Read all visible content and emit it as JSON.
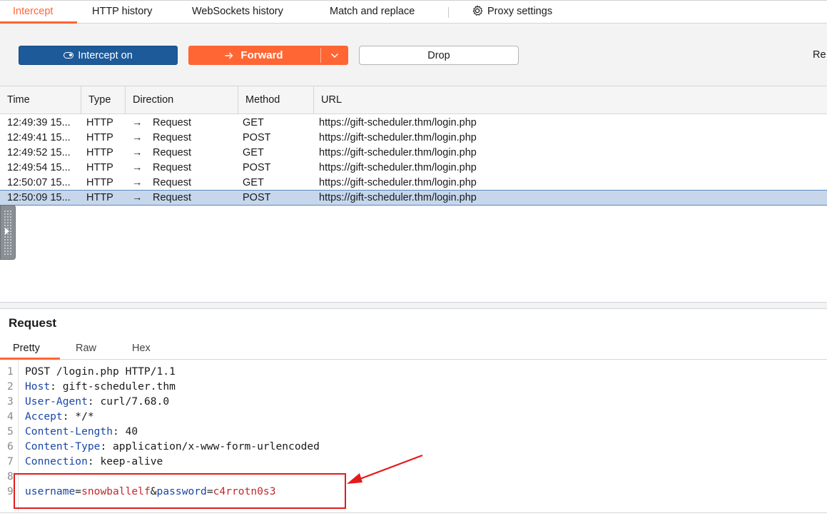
{
  "tabs": {
    "intercept": "Intercept",
    "http_history": "HTTP history",
    "websockets_history": "WebSockets history",
    "match_and_replace": "Match and replace",
    "proxy_settings": "Proxy settings"
  },
  "toolbar": {
    "intercept_label": "Intercept on",
    "forward_label": "Forward",
    "drop_label": "Drop",
    "cut_label": "Re"
  },
  "table": {
    "columns": [
      "Time",
      "Type",
      "Direction",
      "Method",
      "URL"
    ],
    "rows": [
      {
        "time": "12:49:39 15...",
        "type": "HTTP",
        "direction": "Request",
        "method": "GET",
        "url": "https://gift-scheduler.thm/login.php"
      },
      {
        "time": "12:49:41 15...",
        "type": "HTTP",
        "direction": "Request",
        "method": "POST",
        "url": "https://gift-scheduler.thm/login.php"
      },
      {
        "time": "12:49:52 15...",
        "type": "HTTP",
        "direction": "Request",
        "method": "GET",
        "url": "https://gift-scheduler.thm/login.php"
      },
      {
        "time": "12:49:54 15...",
        "type": "HTTP",
        "direction": "Request",
        "method": "POST",
        "url": "https://gift-scheduler.thm/login.php"
      },
      {
        "time": "12:50:07 15...",
        "type": "HTTP",
        "direction": "Request",
        "method": "GET",
        "url": "https://gift-scheduler.thm/login.php"
      },
      {
        "time": "12:50:09 15...",
        "type": "HTTP",
        "direction": "Request",
        "method": "POST",
        "url": "https://gift-scheduler.thm/login.php"
      }
    ],
    "selected_index": 5
  },
  "request": {
    "title": "Request",
    "tabs": [
      "Pretty",
      "Raw",
      "Hex"
    ],
    "lines": [
      {
        "n": "1",
        "key": "",
        "sep": "",
        "value": "POST /login.php HTTP/1.1"
      },
      {
        "n": "2",
        "key": "Host",
        "sep": ": ",
        "value": "gift-scheduler.thm"
      },
      {
        "n": "3",
        "key": "User-Agent",
        "sep": ": ",
        "value": "curl/7.68.0"
      },
      {
        "n": "4",
        "key": "Accept",
        "sep": ": ",
        "value": "*/*"
      },
      {
        "n": "5",
        "key": "Content-Length",
        "sep": ": ",
        "value": "40"
      },
      {
        "n": "6",
        "key": "Content-Type",
        "sep": ": ",
        "value": "application/x-www-form-urlencoded"
      },
      {
        "n": "7",
        "key": "Connection",
        "sep": ": ",
        "value": "keep-alive"
      },
      {
        "n": "8",
        "key": "",
        "sep": "",
        "value": ""
      }
    ],
    "body_line": {
      "n": "9",
      "param1_name": "username",
      "eq1": "=",
      "param1_value": "snowballelf",
      "amp": "&",
      "param2_name": "password",
      "eq2": "=",
      "param2_value": "c4rrotn0s3"
    }
  },
  "colors": {
    "accent": "#ff6633",
    "intercept_blue": "#1d5a99",
    "selection": "#c6d7ec",
    "annotation_red": "#e31b1b"
  }
}
